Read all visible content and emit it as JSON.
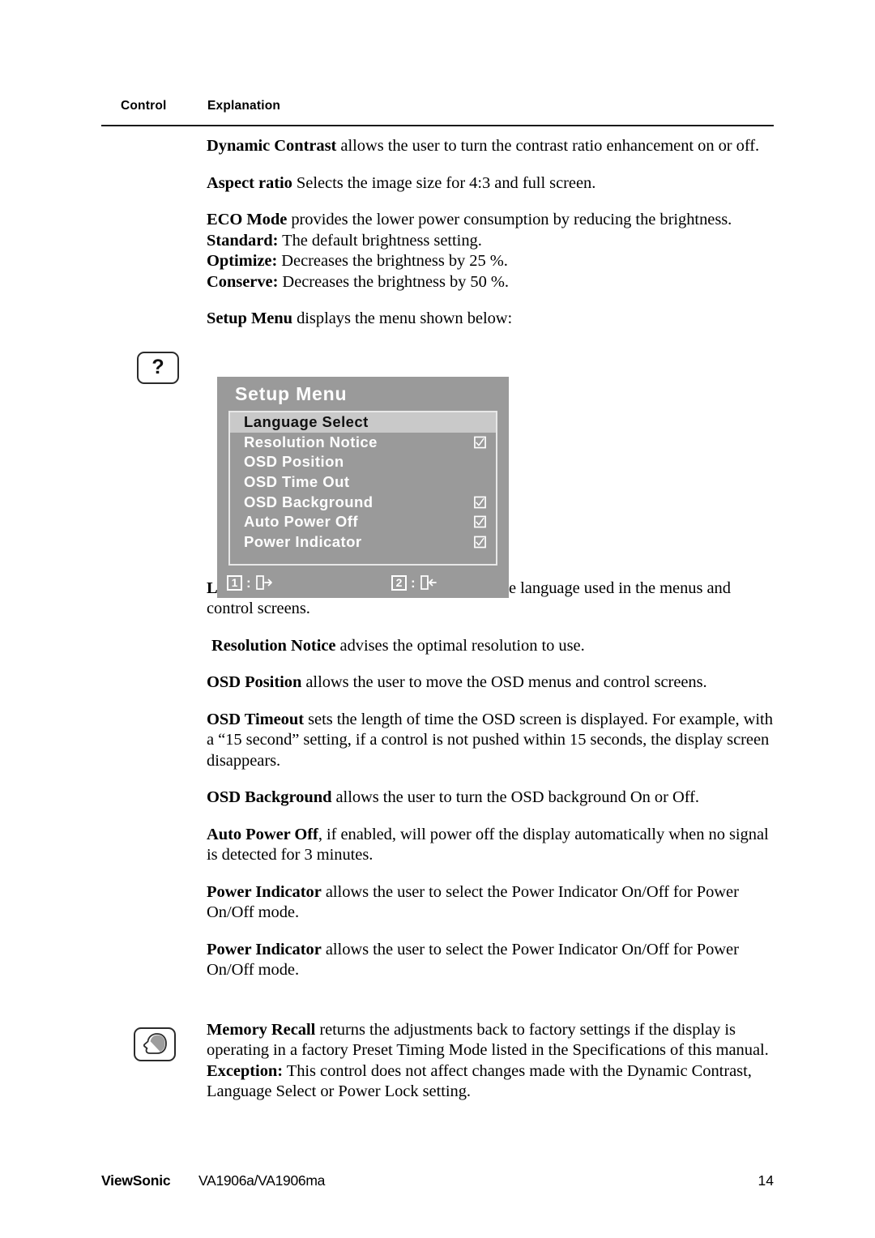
{
  "header": {
    "col_control": "Control",
    "col_explanation": "Explanation"
  },
  "gutter_icons": {
    "question": "?",
    "question_name": "question-mark-icon",
    "memory": "memory-head-icon"
  },
  "paragraphs": {
    "dynamic_contrast": {
      "lead": "Dynamic Contrast",
      "body": " allows the user to turn the contrast ratio enhancement on or off."
    },
    "aspect_ratio": {
      "lead": "Aspect ratio",
      "body": " Selects the image size for 4:3 and full screen."
    },
    "eco_mode": {
      "lead": "ECO Mode",
      "body": " provides the lower power consumption by reducing the brightness."
    },
    "eco_standard": {
      "lead": "Standard:",
      "body": " The default brightness setting."
    },
    "eco_optimize": {
      "lead": "Optimize:",
      "body": " Decreases the brightness by 25 %."
    },
    "eco_conserve": {
      "lead": "Conserve:",
      "body": " Decreases the brightness by 50 %."
    },
    "setup_menu": {
      "lead": "Setup Menu",
      "body": " displays the menu shown below:"
    },
    "language_select": {
      "lead": "Language Select",
      "body": " allows the user to choose the language used in the menus and control screens."
    },
    "resolution_notice": {
      "lead": "Resolution Notice",
      "body": " advises the optimal resolution to use."
    },
    "osd_position": {
      "lead": "OSD Position",
      "body": " allows the user to move the OSD menus and control screens."
    },
    "osd_timeout": {
      "lead": "OSD Timeout",
      "body": " sets the length of time the OSD screen is displayed. For example, with a “15 second” setting, if a control is not pushed within 15 seconds, the display screen disappears."
    },
    "osd_background": {
      "lead": "OSD Background",
      "body": " allows the user to turn the OSD background On or Off."
    },
    "auto_power_off": {
      "lead": "Auto Power Off",
      "body": ", if enabled, will power off the display automatically when no signal is detected for 3 minutes."
    },
    "power_indicator_1": {
      "lead": "Power Indicator",
      "body": " allows the user to select the Power Indicator On/Off for Power On/Off mode."
    },
    "power_indicator_2": {
      "lead": "Power Indicator",
      "body": " allows the user to select the Power Indicator On/Off for Power On/Off mode."
    },
    "memory_recall": {
      "lead": "Memory Recall",
      "body": " returns the adjustments back to factory settings if the display is operating in a factory Preset Timing Mode listed in the Specifications of this manual."
    },
    "memory_exception": {
      "lead": "Exception:",
      "body": " This control does not affect changes made with the Dynamic Contrast, Language Select or Power Lock setting."
    }
  },
  "osd": {
    "title": "Setup Menu",
    "colors": {
      "background": "#9a9a9a",
      "highlight": "#c9c9c9",
      "text": "#ffffff",
      "highlight_text": "#111111",
      "border": "#e8e8e8"
    },
    "items": [
      {
        "label": "Language Select",
        "selected": true,
        "checkbox": false
      },
      {
        "label": "Resolution Notice",
        "selected": false,
        "checkbox": true
      },
      {
        "label": "OSD Position",
        "selected": false,
        "checkbox": false
      },
      {
        "label": "OSD Time Out",
        "selected": false,
        "checkbox": false
      },
      {
        "label": "OSD Background",
        "selected": false,
        "checkbox": true
      },
      {
        "label": "Auto Power Off",
        "selected": false,
        "checkbox": true
      },
      {
        "label": "Power Indicator",
        "selected": false,
        "checkbox": true
      }
    ],
    "footer": [
      {
        "key": "1",
        "separator": ":",
        "icon": "exit-right-icon"
      },
      {
        "key": "2",
        "separator": ":",
        "icon": "exit-left-icon"
      }
    ]
  },
  "footer": {
    "brand": "ViewSonic",
    "model": "VA1906a/VA1906ma",
    "page_number": "14"
  }
}
